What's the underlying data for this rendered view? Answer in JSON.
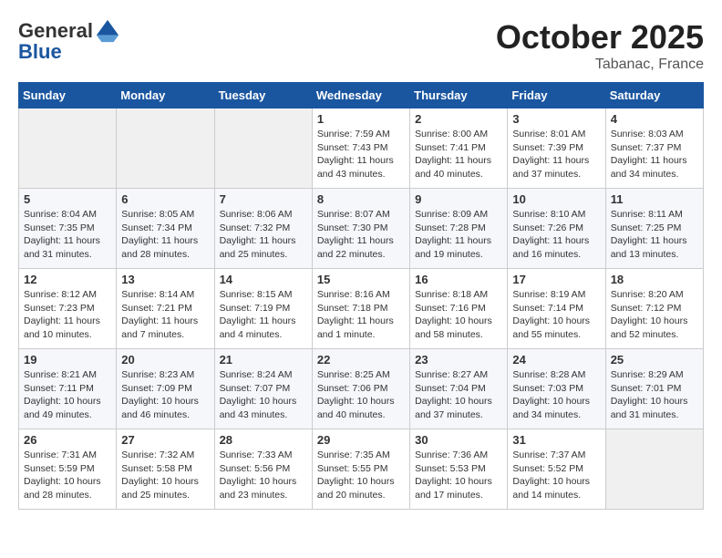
{
  "header": {
    "logo_general": "General",
    "logo_blue": "Blue",
    "month": "October 2025",
    "location": "Tabanac, France"
  },
  "weekdays": [
    "Sunday",
    "Monday",
    "Tuesday",
    "Wednesday",
    "Thursday",
    "Friday",
    "Saturday"
  ],
  "weeks": [
    [
      {
        "day": "",
        "sunrise": "",
        "sunset": "",
        "daylight": ""
      },
      {
        "day": "",
        "sunrise": "",
        "sunset": "",
        "daylight": ""
      },
      {
        "day": "",
        "sunrise": "",
        "sunset": "",
        "daylight": ""
      },
      {
        "day": "1",
        "sunrise": "Sunrise: 7:59 AM",
        "sunset": "Sunset: 7:43 PM",
        "daylight": "Daylight: 11 hours and 43 minutes."
      },
      {
        "day": "2",
        "sunrise": "Sunrise: 8:00 AM",
        "sunset": "Sunset: 7:41 PM",
        "daylight": "Daylight: 11 hours and 40 minutes."
      },
      {
        "day": "3",
        "sunrise": "Sunrise: 8:01 AM",
        "sunset": "Sunset: 7:39 PM",
        "daylight": "Daylight: 11 hours and 37 minutes."
      },
      {
        "day": "4",
        "sunrise": "Sunrise: 8:03 AM",
        "sunset": "Sunset: 7:37 PM",
        "daylight": "Daylight: 11 hours and 34 minutes."
      }
    ],
    [
      {
        "day": "5",
        "sunrise": "Sunrise: 8:04 AM",
        "sunset": "Sunset: 7:35 PM",
        "daylight": "Daylight: 11 hours and 31 minutes."
      },
      {
        "day": "6",
        "sunrise": "Sunrise: 8:05 AM",
        "sunset": "Sunset: 7:34 PM",
        "daylight": "Daylight: 11 hours and 28 minutes."
      },
      {
        "day": "7",
        "sunrise": "Sunrise: 8:06 AM",
        "sunset": "Sunset: 7:32 PM",
        "daylight": "Daylight: 11 hours and 25 minutes."
      },
      {
        "day": "8",
        "sunrise": "Sunrise: 8:07 AM",
        "sunset": "Sunset: 7:30 PM",
        "daylight": "Daylight: 11 hours and 22 minutes."
      },
      {
        "day": "9",
        "sunrise": "Sunrise: 8:09 AM",
        "sunset": "Sunset: 7:28 PM",
        "daylight": "Daylight: 11 hours and 19 minutes."
      },
      {
        "day": "10",
        "sunrise": "Sunrise: 8:10 AM",
        "sunset": "Sunset: 7:26 PM",
        "daylight": "Daylight: 11 hours and 16 minutes."
      },
      {
        "day": "11",
        "sunrise": "Sunrise: 8:11 AM",
        "sunset": "Sunset: 7:25 PM",
        "daylight": "Daylight: 11 hours and 13 minutes."
      }
    ],
    [
      {
        "day": "12",
        "sunrise": "Sunrise: 8:12 AM",
        "sunset": "Sunset: 7:23 PM",
        "daylight": "Daylight: 11 hours and 10 minutes."
      },
      {
        "day": "13",
        "sunrise": "Sunrise: 8:14 AM",
        "sunset": "Sunset: 7:21 PM",
        "daylight": "Daylight: 11 hours and 7 minutes."
      },
      {
        "day": "14",
        "sunrise": "Sunrise: 8:15 AM",
        "sunset": "Sunset: 7:19 PM",
        "daylight": "Daylight: 11 hours and 4 minutes."
      },
      {
        "day": "15",
        "sunrise": "Sunrise: 8:16 AM",
        "sunset": "Sunset: 7:18 PM",
        "daylight": "Daylight: 11 hours and 1 minute."
      },
      {
        "day": "16",
        "sunrise": "Sunrise: 8:18 AM",
        "sunset": "Sunset: 7:16 PM",
        "daylight": "Daylight: 10 hours and 58 minutes."
      },
      {
        "day": "17",
        "sunrise": "Sunrise: 8:19 AM",
        "sunset": "Sunset: 7:14 PM",
        "daylight": "Daylight: 10 hours and 55 minutes."
      },
      {
        "day": "18",
        "sunrise": "Sunrise: 8:20 AM",
        "sunset": "Sunset: 7:12 PM",
        "daylight": "Daylight: 10 hours and 52 minutes."
      }
    ],
    [
      {
        "day": "19",
        "sunrise": "Sunrise: 8:21 AM",
        "sunset": "Sunset: 7:11 PM",
        "daylight": "Daylight: 10 hours and 49 minutes."
      },
      {
        "day": "20",
        "sunrise": "Sunrise: 8:23 AM",
        "sunset": "Sunset: 7:09 PM",
        "daylight": "Daylight: 10 hours and 46 minutes."
      },
      {
        "day": "21",
        "sunrise": "Sunrise: 8:24 AM",
        "sunset": "Sunset: 7:07 PM",
        "daylight": "Daylight: 10 hours and 43 minutes."
      },
      {
        "day": "22",
        "sunrise": "Sunrise: 8:25 AM",
        "sunset": "Sunset: 7:06 PM",
        "daylight": "Daylight: 10 hours and 40 minutes."
      },
      {
        "day": "23",
        "sunrise": "Sunrise: 8:27 AM",
        "sunset": "Sunset: 7:04 PM",
        "daylight": "Daylight: 10 hours and 37 minutes."
      },
      {
        "day": "24",
        "sunrise": "Sunrise: 8:28 AM",
        "sunset": "Sunset: 7:03 PM",
        "daylight": "Daylight: 10 hours and 34 minutes."
      },
      {
        "day": "25",
        "sunrise": "Sunrise: 8:29 AM",
        "sunset": "Sunset: 7:01 PM",
        "daylight": "Daylight: 10 hours and 31 minutes."
      }
    ],
    [
      {
        "day": "26",
        "sunrise": "Sunrise: 7:31 AM",
        "sunset": "Sunset: 5:59 PM",
        "daylight": "Daylight: 10 hours and 28 minutes."
      },
      {
        "day": "27",
        "sunrise": "Sunrise: 7:32 AM",
        "sunset": "Sunset: 5:58 PM",
        "daylight": "Daylight: 10 hours and 25 minutes."
      },
      {
        "day": "28",
        "sunrise": "Sunrise: 7:33 AM",
        "sunset": "Sunset: 5:56 PM",
        "daylight": "Daylight: 10 hours and 23 minutes."
      },
      {
        "day": "29",
        "sunrise": "Sunrise: 7:35 AM",
        "sunset": "Sunset: 5:55 PM",
        "daylight": "Daylight: 10 hours and 20 minutes."
      },
      {
        "day": "30",
        "sunrise": "Sunrise: 7:36 AM",
        "sunset": "Sunset: 5:53 PM",
        "daylight": "Daylight: 10 hours and 17 minutes."
      },
      {
        "day": "31",
        "sunrise": "Sunrise: 7:37 AM",
        "sunset": "Sunset: 5:52 PM",
        "daylight": "Daylight: 10 hours and 14 minutes."
      },
      {
        "day": "",
        "sunrise": "",
        "sunset": "",
        "daylight": ""
      }
    ]
  ]
}
